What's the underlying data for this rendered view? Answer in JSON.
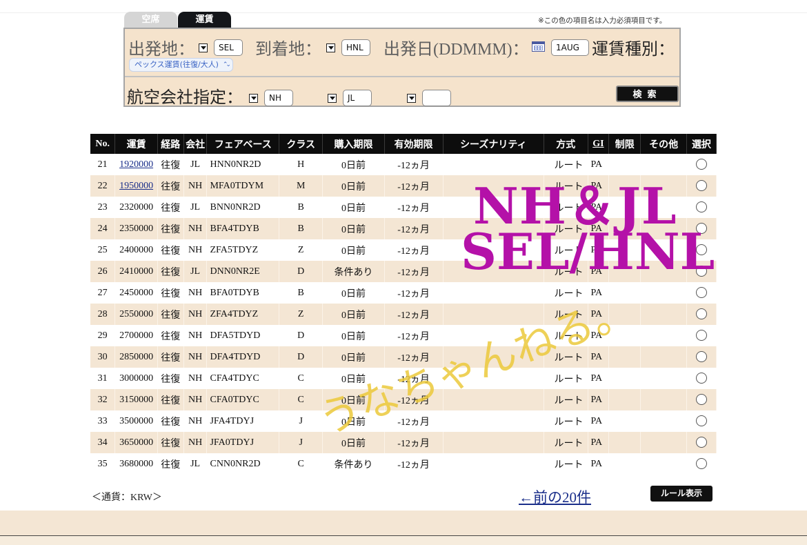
{
  "tabs": [
    {
      "label": "空席",
      "active": false
    },
    {
      "label": "運賃",
      "active": true
    }
  ],
  "required_note": "※この色の項目名は入力必須項目です。",
  "form": {
    "origin_label": "出発地：",
    "origin_value": "SEL",
    "destination_label": "到着地：",
    "destination_value": "HNL",
    "date_label": "出発日(DDMMM)：",
    "date_value": "1AUG",
    "fare_type_label": "運賃種別：",
    "fare_type_value": "ペックス運賃(往復/大人)",
    "airline_label": "航空会社指定：",
    "airline_1": "NH",
    "airline_2": "JL",
    "airline_3": "",
    "search_label": "検索"
  },
  "table": {
    "headers": [
      "No.",
      "運賃",
      "経路",
      "会社",
      "フェアベース",
      "クラス",
      "購入期限",
      "有効期限",
      "シーズナリティ",
      "方式",
      "GI",
      "制限",
      "その他",
      "選択"
    ],
    "rows": [
      {
        "no": "21",
        "fare": "1920000",
        "route": "往復",
        "carrier": "JL",
        "fare_basis": "HNN0NR2D",
        "class": "H",
        "purchase": "0日前",
        "validity": "-12ヵ月",
        "season": "",
        "method": "ルート",
        "gi": "PA",
        "restriction": "",
        "other": "",
        "link": true
      },
      {
        "no": "22",
        "fare": "1950000",
        "route": "往復",
        "carrier": "NH",
        "fare_basis": "MFA0TDYM",
        "class": "M",
        "purchase": "0日前",
        "validity": "-12ヵ月",
        "season": "",
        "method": "ルート",
        "gi": "PA",
        "restriction": "",
        "other": "",
        "link": true
      },
      {
        "no": "23",
        "fare": "2320000",
        "route": "往復",
        "carrier": "JL",
        "fare_basis": "BNN0NR2D",
        "class": "B",
        "purchase": "0日前",
        "validity": "-12ヵ月",
        "season": "",
        "method": "ルート",
        "gi": "PA",
        "restriction": "",
        "other": "",
        "link": false
      },
      {
        "no": "24",
        "fare": "2350000",
        "route": "往復",
        "carrier": "NH",
        "fare_basis": "BFA4TDYB",
        "class": "B",
        "purchase": "0日前",
        "validity": "-12ヵ月",
        "season": "",
        "method": "ルート",
        "gi": "PA",
        "restriction": "",
        "other": "",
        "link": false
      },
      {
        "no": "25",
        "fare": "2400000",
        "route": "往復",
        "carrier": "NH",
        "fare_basis": "ZFA5TDYZ",
        "class": "Z",
        "purchase": "0日前",
        "validity": "-12ヵ月",
        "season": "",
        "method": "ルート",
        "gi": "PA",
        "restriction": "",
        "other": "",
        "link": false
      },
      {
        "no": "26",
        "fare": "2410000",
        "route": "往復",
        "carrier": "JL",
        "fare_basis": "DNN0NR2E",
        "class": "D",
        "purchase": "条件あり",
        "validity": "-12ヵ月",
        "season": "",
        "method": "ルート",
        "gi": "PA",
        "restriction": "",
        "other": "",
        "link": false
      },
      {
        "no": "27",
        "fare": "2450000",
        "route": "往復",
        "carrier": "NH",
        "fare_basis": "BFA0TDYB",
        "class": "B",
        "purchase": "0日前",
        "validity": "-12ヵ月",
        "season": "",
        "method": "ルート",
        "gi": "PA",
        "restriction": "",
        "other": "",
        "link": false
      },
      {
        "no": "28",
        "fare": "2550000",
        "route": "往復",
        "carrier": "NH",
        "fare_basis": "ZFA4TDYZ",
        "class": "Z",
        "purchase": "0日前",
        "validity": "-12ヵ月",
        "season": "",
        "method": "ルート",
        "gi": "PA",
        "restriction": "",
        "other": "",
        "link": false
      },
      {
        "no": "29",
        "fare": "2700000",
        "route": "往復",
        "carrier": "NH",
        "fare_basis": "DFA5TDYD",
        "class": "D",
        "purchase": "0日前",
        "validity": "-12ヵ月",
        "season": "",
        "method": "ルート",
        "gi": "PA",
        "restriction": "",
        "other": "",
        "link": false
      },
      {
        "no": "30",
        "fare": "2850000",
        "route": "往復",
        "carrier": "NH",
        "fare_basis": "DFA4TDYD",
        "class": "D",
        "purchase": "0日前",
        "validity": "-12ヵ月",
        "season": "",
        "method": "ルート",
        "gi": "PA",
        "restriction": "",
        "other": "",
        "link": false
      },
      {
        "no": "31",
        "fare": "3000000",
        "route": "往復",
        "carrier": "NH",
        "fare_basis": "CFA4TDYC",
        "class": "C",
        "purchase": "0日前",
        "validity": "-12ヵ月",
        "season": "",
        "method": "ルート",
        "gi": "PA",
        "restriction": "",
        "other": "",
        "link": false
      },
      {
        "no": "32",
        "fare": "3150000",
        "route": "往復",
        "carrier": "NH",
        "fare_basis": "CFA0TDYC",
        "class": "C",
        "purchase": "0日前",
        "validity": "-12ヵ月",
        "season": "",
        "method": "ルート",
        "gi": "PA",
        "restriction": "",
        "other": "",
        "link": false
      },
      {
        "no": "33",
        "fare": "3500000",
        "route": "往復",
        "carrier": "NH",
        "fare_basis": "JFA4TDYJ",
        "class": "J",
        "purchase": "0日前",
        "validity": "-12ヵ月",
        "season": "",
        "method": "ルート",
        "gi": "PA",
        "restriction": "",
        "other": "",
        "link": false
      },
      {
        "no": "34",
        "fare": "3650000",
        "route": "往復",
        "carrier": "NH",
        "fare_basis": "JFA0TDYJ",
        "class": "J",
        "purchase": "0日前",
        "validity": "-12ヵ月",
        "season": "",
        "method": "ルート",
        "gi": "PA",
        "restriction": "",
        "other": "",
        "link": false
      },
      {
        "no": "35",
        "fare": "3680000",
        "route": "往復",
        "carrier": "JL",
        "fare_basis": "CNN0NR2D",
        "class": "C",
        "purchase": "条件あり",
        "validity": "-12ヵ月",
        "season": "",
        "method": "ルート",
        "gi": "PA",
        "restriction": "",
        "other": "",
        "link": false
      }
    ]
  },
  "currency": "＜通貨：KRW＞",
  "prev_link": "←前の20件",
  "rule_button": "ルール表示",
  "overlay": {
    "line1": "NH＆JL",
    "line2": "SEL/HNL",
    "handwriting": "うなちゃんねる。",
    "line_color": "#b411a8",
    "handwriting_color": "#ecc93b"
  },
  "colors": {
    "header_bg": "#0d0d0d",
    "row_alt": "#f4e6d4",
    "form_bg": "#f5e3cc",
    "link": "#1a2e8a"
  }
}
